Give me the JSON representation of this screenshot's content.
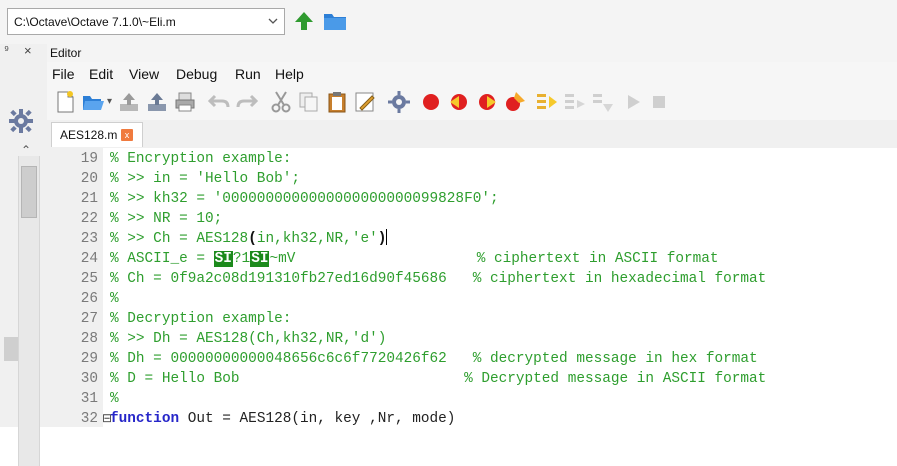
{
  "path_bar": {
    "current_path": "C:\\Octave\\Octave 7.1.0\\~Eli.m"
  },
  "editor": {
    "title": "Editor",
    "menu": [
      "File",
      "Edit",
      "View",
      "Debug",
      "Run",
      "Help"
    ],
    "tab_label": "AES128.m",
    "tab_close": "x"
  },
  "code_lines": [
    {
      "num": "19",
      "parts": [
        {
          "t": "% Encryption example:",
          "c": "cmt"
        }
      ]
    },
    {
      "num": "20",
      "parts": [
        {
          "t": "% >> in = 'Hello Bob';",
          "c": "cmt"
        }
      ]
    },
    {
      "num": "21",
      "parts": [
        {
          "t": "% >> kh32 = '0000000000000000000000099828F0';",
          "c": "cmt"
        }
      ]
    },
    {
      "num": "22",
      "parts": [
        {
          "t": "% >> NR = 10;",
          "c": "cmt"
        }
      ]
    },
    {
      "num": "23",
      "parts": [
        {
          "t": "% >> Ch = AES128",
          "c": "cmt"
        },
        {
          "t": "(",
          "c": "paren"
        },
        {
          "t": "in,kh32,NR,'e'",
          "c": "cmt"
        },
        {
          "t": ")",
          "c": "paren"
        }
      ]
    },
    {
      "num": "24",
      "parts": [
        {
          "t": "% ASCII_e = ",
          "c": "cmt"
        },
        {
          "t": "SI",
          "c": "ctrl"
        },
        {
          "t": "?1",
          "c": "cmt"
        },
        {
          "t": "SI",
          "c": "ctrl"
        },
        {
          "t": "~mV                     % ciphertext in ASCII format",
          "c": "cmt"
        }
      ]
    },
    {
      "num": "25",
      "parts": [
        {
          "t": "% Ch = 0f9a2c08d191310fb27ed16d90f45686   % ciphertext in hexadecimal format",
          "c": "cmt"
        }
      ]
    },
    {
      "num": "26",
      "parts": [
        {
          "t": "%",
          "c": "cmt"
        }
      ]
    },
    {
      "num": "27",
      "parts": [
        {
          "t": "% Decryption example:",
          "c": "cmt"
        }
      ]
    },
    {
      "num": "28",
      "parts": [
        {
          "t": "% >> Dh = AES128(Ch,kh32,NR,'d')",
          "c": "cmt"
        }
      ]
    },
    {
      "num": "29",
      "parts": [
        {
          "t": "% Dh = 00000000000048656c6c6f7720426f62   % decrypted message in hex format",
          "c": "cmt"
        }
      ]
    },
    {
      "num": "30",
      "parts": [
        {
          "t": "% D = Hello Bob                          % Decrypted message in ASCII format",
          "c": "cmt"
        }
      ]
    },
    {
      "num": "31",
      "parts": [
        {
          "t": "%",
          "c": "cmt"
        }
      ]
    },
    {
      "num": "32",
      "fold": "⊟",
      "parts": [
        {
          "t": "function",
          "c": "kw"
        },
        {
          "t": " Out = AES128(in, key ,Nr, mode)",
          "c": "plain"
        }
      ]
    }
  ],
  "icons": {
    "up": "arrow-up-icon",
    "folder": "folder-icon"
  },
  "colors": {
    "comment": "#2e9e2e",
    "keyword": "#2626c9",
    "record": "#e02020"
  }
}
